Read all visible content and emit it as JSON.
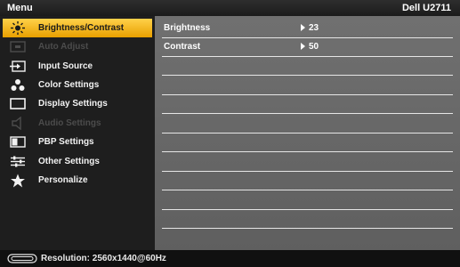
{
  "header": {
    "title": "Menu",
    "model": "Dell U2711"
  },
  "sidebar": {
    "items": [
      {
        "label": "Brightness/Contrast",
        "icon": "brightness-icon",
        "state": "selected"
      },
      {
        "label": "Auto Adjust",
        "icon": "auto-adjust-icon",
        "state": "disabled"
      },
      {
        "label": "Input Source",
        "icon": "input-source-icon",
        "state": "normal"
      },
      {
        "label": "Color Settings",
        "icon": "color-settings-icon",
        "state": "normal"
      },
      {
        "label": "Display Settings",
        "icon": "display-settings-icon",
        "state": "normal"
      },
      {
        "label": "Audio Settings",
        "icon": "speaker-icon",
        "state": "disabled"
      },
      {
        "label": "PBP Settings",
        "icon": "pbp-icon",
        "state": "normal"
      },
      {
        "label": "Other Settings",
        "icon": "sliders-icon",
        "state": "normal"
      },
      {
        "label": "Personalize",
        "icon": "star-icon",
        "state": "normal"
      }
    ]
  },
  "panel": {
    "rows": [
      {
        "name": "Brightness",
        "value": "23"
      },
      {
        "name": "Contrast",
        "value": "50"
      },
      {
        "name": "",
        "value": ""
      },
      {
        "name": "",
        "value": ""
      },
      {
        "name": "",
        "value": ""
      },
      {
        "name": "",
        "value": ""
      },
      {
        "name": "",
        "value": ""
      },
      {
        "name": "",
        "value": ""
      },
      {
        "name": "",
        "value": ""
      },
      {
        "name": "",
        "value": ""
      },
      {
        "name": "",
        "value": ""
      }
    ]
  },
  "footer": {
    "resolution": "Resolution: 2560x1440@60Hz",
    "icon": "resolution-icon"
  },
  "colors": {
    "accent": "#f5b400",
    "panel": "#6a6a6a",
    "disabled": "#4c4c4c"
  }
}
